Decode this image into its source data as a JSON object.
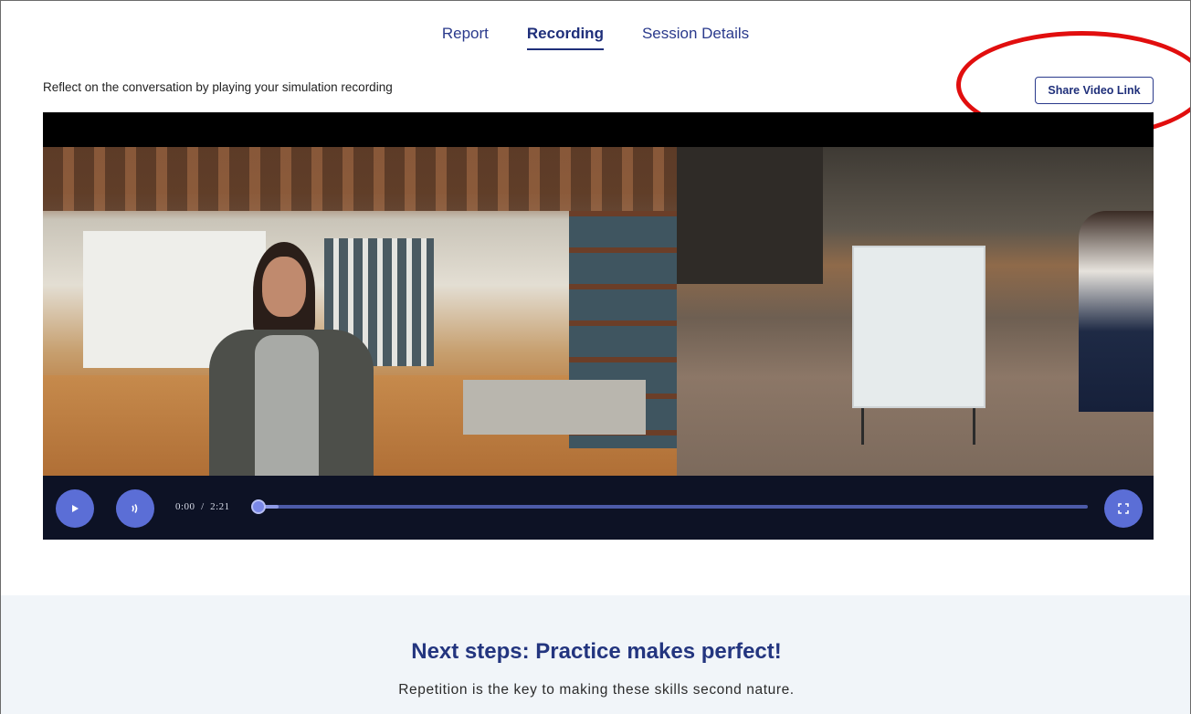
{
  "tabs": [
    {
      "label": "Report",
      "active": false
    },
    {
      "label": "Recording",
      "active": true
    },
    {
      "label": "Session Details",
      "active": false
    }
  ],
  "recording": {
    "intro_text": "Reflect on the conversation by playing your simulation recording",
    "share_button_label": "Share Video Link"
  },
  "player": {
    "current_time": "0:00",
    "time_separator": "/",
    "duration": "2:21",
    "progress_fraction": 0.0,
    "icons": {
      "play": "play-icon",
      "volume": "volume-icon",
      "fullscreen": "fullscreen-icon"
    }
  },
  "next_steps": {
    "title": "Next steps: Practice makes perfect!",
    "subtitle": "Repetition is the key to making these skills second nature."
  },
  "colors": {
    "accent": "#23357f",
    "annotation_ring": "#e10e0e",
    "control_button": "#5b6ed6"
  }
}
